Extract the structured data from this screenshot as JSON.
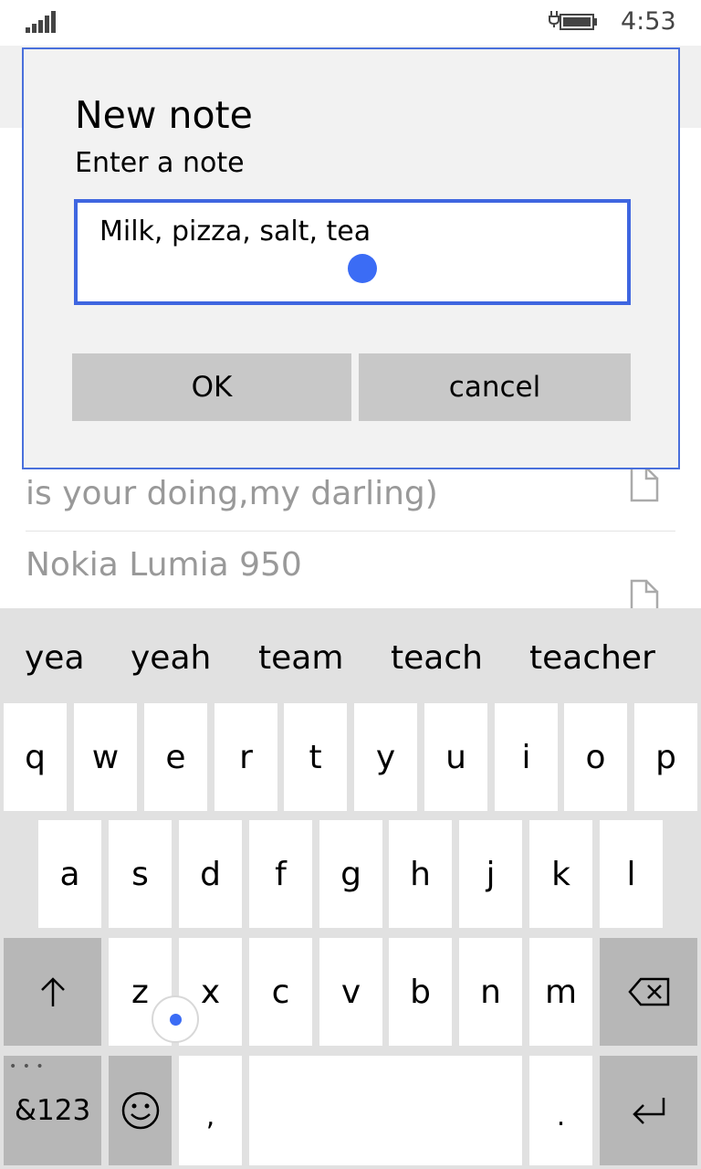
{
  "status_bar": {
    "time": "4:53",
    "signal_icon": "signal-bars-icon",
    "battery_icon": "battery-charging-icon"
  },
  "background": {
    "note_1_text": "is your doing,my darling)",
    "note_2_text": "Nokia Lumia 950",
    "note_icon": "document-icon"
  },
  "dialog": {
    "title": "New note",
    "subtitle": "Enter a note",
    "input_value": "Milk, pizza, salt, tea",
    "ok_label": "OK",
    "cancel_label": "cancel",
    "accent_color": "#3f66e0"
  },
  "keyboard": {
    "suggestions": [
      "yea",
      "yeah",
      "team",
      "teach",
      "teacher"
    ],
    "row1": [
      "q",
      "w",
      "e",
      "r",
      "t",
      "y",
      "u",
      "i",
      "o",
      "p"
    ],
    "row2": [
      "a",
      "s",
      "d",
      "f",
      "g",
      "h",
      "j",
      "k",
      "l"
    ],
    "row3": [
      "z",
      "x",
      "c",
      "v",
      "b",
      "n",
      "m"
    ],
    "shift_icon": "shift-arrow-icon",
    "backspace_icon": "backspace-icon",
    "symbols_label": "&123",
    "symbols_dots": "• • •",
    "emoji_icon": "smiley-icon",
    "comma_label": ",",
    "period_label": ".",
    "enter_icon": "enter-icon"
  }
}
